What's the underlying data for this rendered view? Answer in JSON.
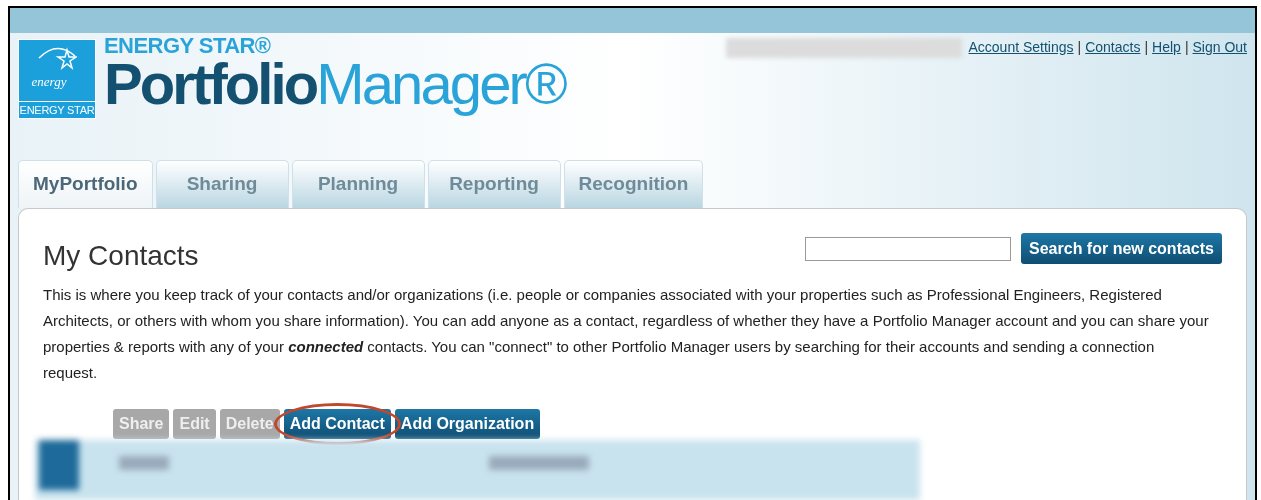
{
  "logo": {
    "script_word": "energy",
    "badge_label": "ENERGY STAR",
    "brand_line": "ENERGY STAR®",
    "product_first": "Portfolio",
    "product_second": "Manager®"
  },
  "account_links": [
    {
      "label": "Account Settings"
    },
    {
      "label": "Contacts"
    },
    {
      "label": "Help"
    },
    {
      "label": "Sign Out"
    }
  ],
  "link_separator": "|",
  "tabs": [
    {
      "label": "MyPortfolio",
      "selected": true
    },
    {
      "label": "Sharing",
      "selected": false
    },
    {
      "label": "Planning",
      "selected": false
    },
    {
      "label": "Reporting",
      "selected": false
    },
    {
      "label": "Recognition",
      "selected": false
    }
  ],
  "page_title": "My Contacts",
  "search": {
    "button": "Search for new contacts"
  },
  "intro": "This is where you keep track of your contacts and/or organizations (i.e. people or companies associated with your properties such as Professional Engineers, Registered Architects, or others with whom you share information). You can add anyone as a contact, regardless of whether they have a Portfolio Manager account and you can share your properties & reports with any of your **connected** contacts. You can \"connect\" to other Portfolio Manager users by searching for their accounts and sending a connection request.",
  "actions": [
    {
      "label": "Share",
      "disabled": true,
      "highlighted": false
    },
    {
      "label": "Edit",
      "disabled": true,
      "highlighted": false
    },
    {
      "label": "Delete",
      "disabled": true,
      "highlighted": false
    },
    {
      "label": "Add Contact",
      "disabled": false,
      "highlighted": true
    },
    {
      "label": "Add Organization",
      "disabled": false,
      "highlighted": false
    }
  ]
}
